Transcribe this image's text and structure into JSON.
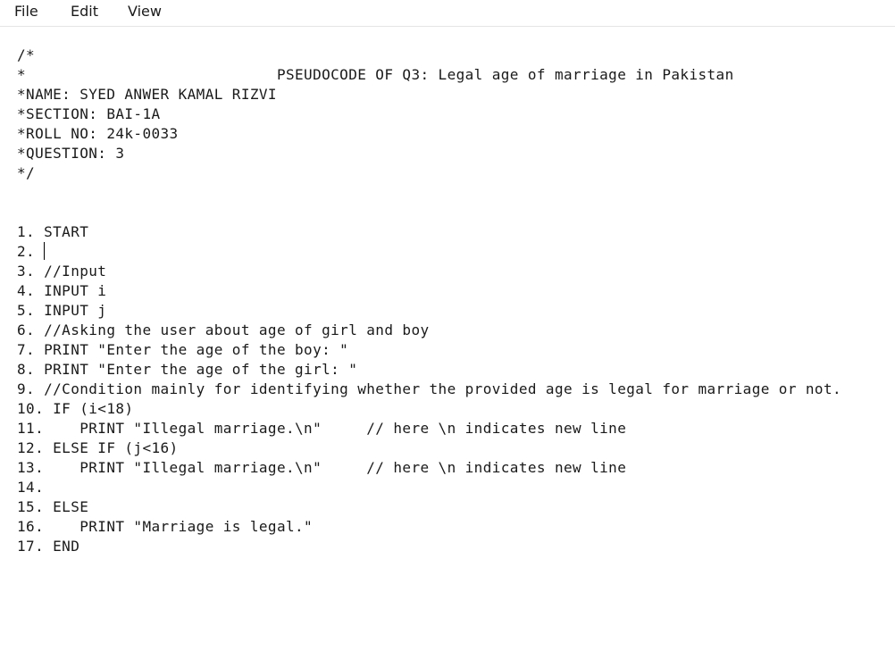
{
  "menu": {
    "file": "File",
    "edit": "Edit",
    "view": "View"
  },
  "editor": {
    "content": "/*\n*                            PSEUDOCODE OF Q3: Legal age of marriage in Pakistan\n*NAME: SYED ANWER KAMAL RIZVI\n*SECTION: BAI-1A\n*ROLL NO: 24k-0033\n*QUESTION: 3\n*/\n\n\n1. START\n2. \n3. //Input\n4. INPUT i\n5. INPUT j\n6. //Asking the user about age of girl and boy\n7. PRINT \"Enter the age of the boy: \"\n8. PRINT \"Enter the age of the girl: \"\n9. //Condition mainly for identifying whether the provided age is legal for marriage or not.\n10. IF (i<18)\n11.    PRINT \"Illegal marriage.\\n\"     // here \\n indicates new line\n12. ELSE IF (j<16)\n13.    PRINT \"Illegal marriage.\\n\"     // here \\n indicates new line\n14.\n15. ELSE\n16.    PRINT \"Marriage is legal.\"\n17. END"
  }
}
